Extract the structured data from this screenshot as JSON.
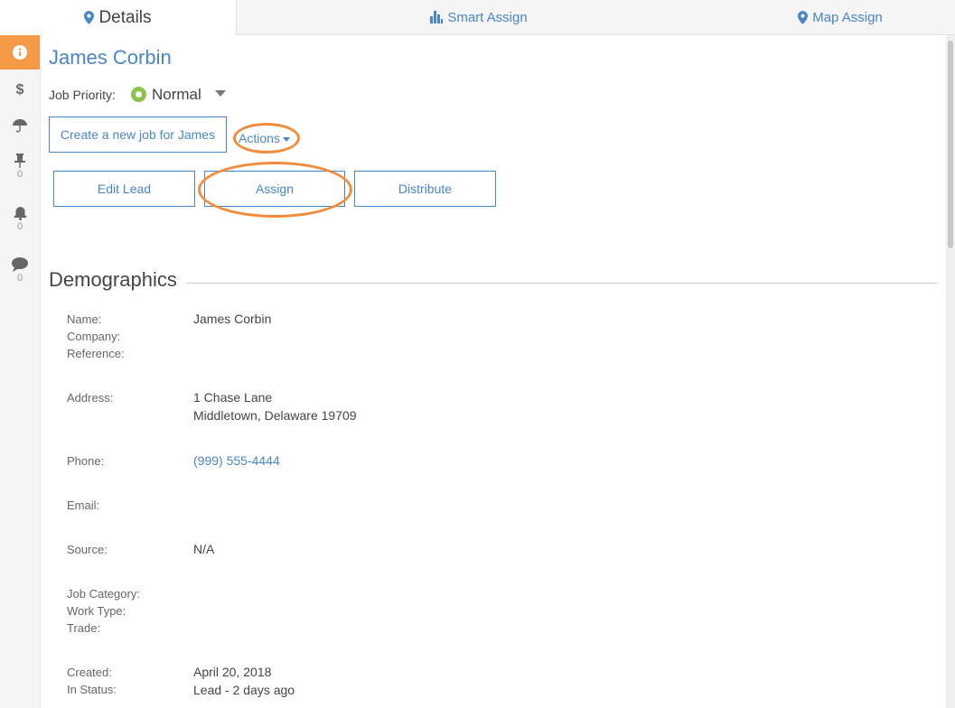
{
  "tabs": {
    "details": "Details",
    "smart_assign": "Smart Assign",
    "map_assign": "Map Assign"
  },
  "sidebar": {
    "pin_count": "0",
    "bell_count": "0",
    "comment_count": "0"
  },
  "lead": {
    "name": "James Corbin",
    "priority_label": "Job Priority:",
    "priority_value": "Normal"
  },
  "actions": {
    "create_job": "Create a new job for James",
    "actions_label": "Actions",
    "edit_lead": "Edit Lead",
    "assign": "Assign",
    "distribute": "Distribute"
  },
  "demographics": {
    "title": "Demographics",
    "name_label": "Name:",
    "company_label": "Company:",
    "reference_label": "Reference:",
    "name_value": "James Corbin",
    "address_label": "Address:",
    "address_line1": "1 Chase Lane",
    "address_line2": "Middletown, Delaware 19709",
    "phone_label": "Phone:",
    "phone_value": "(999) 555-4444",
    "email_label": "Email:",
    "source_label": "Source:",
    "source_value": "N/A",
    "job_category_label": "Job Category:",
    "work_type_label": "Work Type:",
    "trade_label": "Trade:",
    "created_label": "Created:",
    "created_value": "April 20, 2018",
    "in_status_label": "In Status:",
    "in_status_value": "Lead - 2 days ago"
  },
  "colors": {
    "accent": "#4a86c5",
    "sidebar_active": "#f59a47",
    "highlight": "#f08c3c",
    "priority_normal": "#8bc34a"
  }
}
